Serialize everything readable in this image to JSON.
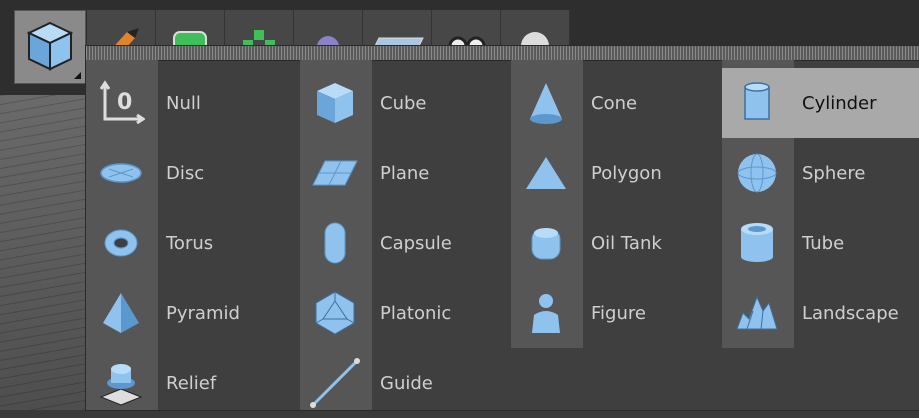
{
  "toolbar": {
    "buttons": [
      {
        "name": "cube-tool",
        "icon": "cube-icon"
      },
      {
        "name": "pen-tool",
        "icon": "pen-icon"
      },
      {
        "name": "subdivision-tool",
        "icon": "subdivision-icon"
      },
      {
        "name": "array-tool",
        "icon": "array-icon"
      },
      {
        "name": "deformer-tool",
        "icon": "deformer-icon"
      },
      {
        "name": "environment-tool",
        "icon": "floor-icon"
      },
      {
        "name": "camera-tool",
        "icon": "camera-icon"
      },
      {
        "name": "light-tool",
        "icon": "light-icon"
      }
    ]
  },
  "menu": {
    "columns": [
      {
        "items": [
          {
            "label": "Null",
            "icon": "null-icon"
          },
          {
            "label": "Disc",
            "icon": "disc-icon"
          },
          {
            "label": "Torus",
            "icon": "torus-icon"
          },
          {
            "label": "Pyramid",
            "icon": "pyramid-icon"
          },
          {
            "label": "Relief",
            "icon": "relief-icon"
          }
        ]
      },
      {
        "items": [
          {
            "label": "Cube",
            "icon": "cube-icon"
          },
          {
            "label": "Plane",
            "icon": "plane-icon"
          },
          {
            "label": "Capsule",
            "icon": "capsule-icon"
          },
          {
            "label": "Platonic",
            "icon": "platonic-icon"
          },
          {
            "label": "Guide",
            "icon": "guide-icon"
          }
        ]
      },
      {
        "items": [
          {
            "label": "Cone",
            "icon": "cone-icon"
          },
          {
            "label": "Polygon",
            "icon": "polygon-icon"
          },
          {
            "label": "Oil Tank",
            "icon": "oil-tank-icon"
          },
          {
            "label": "Figure",
            "icon": "figure-icon"
          }
        ]
      },
      {
        "items": [
          {
            "label": "Cylinder",
            "icon": "cylinder-icon",
            "highlighted": true
          },
          {
            "label": "Sphere",
            "icon": "sphere-icon"
          },
          {
            "label": "Tube",
            "icon": "tube-icon"
          },
          {
            "label": "Landscape",
            "icon": "landscape-icon"
          }
        ]
      }
    ]
  },
  "colors": {
    "icon_blue": "#8fc3ee",
    "icon_blue_dark": "#5b98cf",
    "highlight": "#a9a9a9"
  }
}
